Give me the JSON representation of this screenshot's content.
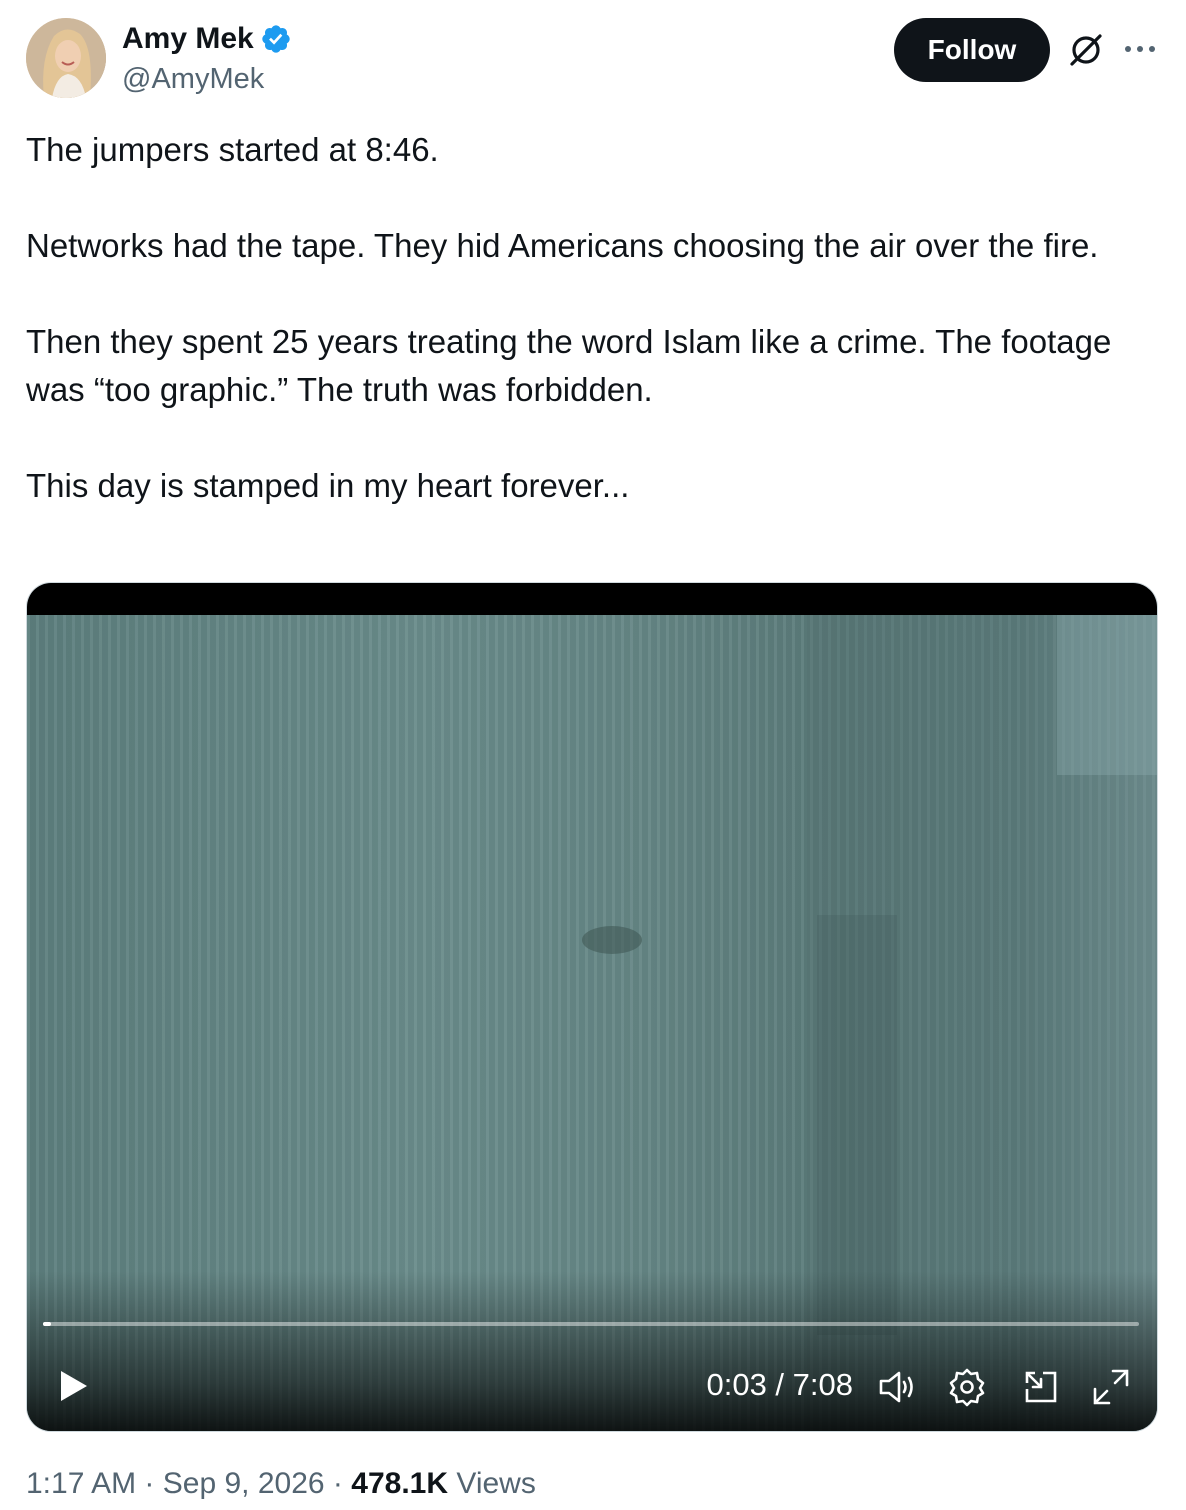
{
  "author": {
    "display_name": "Amy Mek",
    "handle": "@AmyMek",
    "verified": true,
    "avatar_icon": "profile-photo"
  },
  "actions": {
    "follow_label": "Follow",
    "grok_icon": "grok-icon",
    "more_icon": "more-icon"
  },
  "tweet": {
    "paragraphs": [
      "The jumpers started at 8:46.",
      "Networks had the tape. They hid Americans choosing the air over the fire.",
      "Then they spent 25 years treating the word Islam like a crime. The footage was “too graphic.”  The truth was forbidden.",
      "This day is stamped in my heart forever..."
    ]
  },
  "video": {
    "time_display": "0:03 / 7:08",
    "progress_fraction": 0.007,
    "controls": [
      "play-icon",
      "volume-icon",
      "settings-icon",
      "pip-icon",
      "fullscreen-icon"
    ]
  },
  "meta": {
    "time": "1:17 AM",
    "separator": "·",
    "date": "Sep 9, 2026",
    "views_count": "478.1K",
    "views_label": "Views"
  },
  "colors": {
    "text_primary": "#0f1419",
    "text_secondary": "#536471",
    "verified_blue": "#1d9bf0",
    "button_dark": "#0f1419"
  }
}
